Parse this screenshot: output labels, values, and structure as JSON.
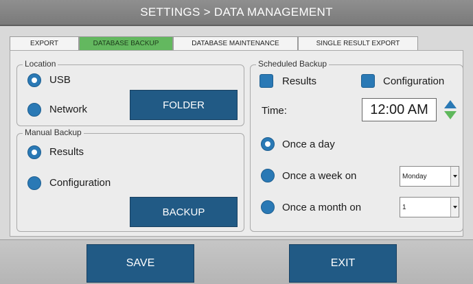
{
  "header": {
    "title": "SETTINGS > DATA MANAGEMENT"
  },
  "tabs": [
    {
      "label": "EXPORT",
      "active": false
    },
    {
      "label": "DATABASE BACKUP",
      "active": true
    },
    {
      "label": "DATABASE MAINTENANCE",
      "active": false
    },
    {
      "label": "SINGLE RESULT EXPORT",
      "active": false
    }
  ],
  "location": {
    "legend": "Location",
    "options": [
      "USB",
      "Network"
    ],
    "selected": "USB",
    "folder_label": "FOLDER"
  },
  "manual_backup": {
    "legend": "Manual Backup",
    "options": [
      "Results",
      "Configuration"
    ],
    "selected": "Results",
    "backup_label": "BACKUP"
  },
  "scheduled_backup": {
    "legend": "Scheduled Backup",
    "checkboxes": [
      "Results",
      "Configuration"
    ],
    "time_label": "Time:",
    "time_value": "12:00 AM",
    "frequency": [
      "Once a day",
      "Once a week on",
      "Once a month on"
    ],
    "selected": "Once a day",
    "week_day": "Monday",
    "month_day": "1"
  },
  "footer": {
    "save_label": "SAVE",
    "exit_label": "EXIT"
  },
  "colors": {
    "accent_blue": "#2a79b5",
    "button_blue": "#215a85",
    "active_tab_green": "#63b85f",
    "header_gray": "#858585"
  }
}
